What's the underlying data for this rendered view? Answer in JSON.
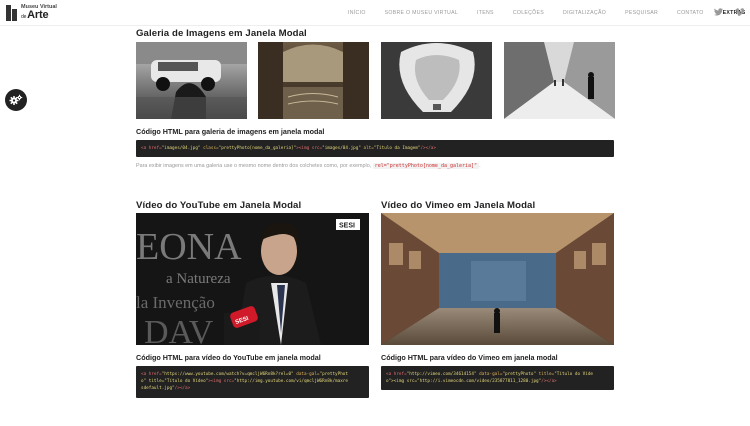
{
  "header": {
    "logo_line1": "Museu Virtual",
    "logo_de": "de",
    "logo_line2": "Arte",
    "nav": [
      {
        "label": "INÍCIO"
      },
      {
        "label": "SOBRE O MUSEU VIRTUAL"
      },
      {
        "label": "ITENS"
      },
      {
        "label": "COLEÇÕES"
      },
      {
        "label": "DIGITALIZAÇÃO"
      },
      {
        "label": "PESQUISAR"
      },
      {
        "label": "CONTATO"
      },
      {
        "label": "EXTRAS"
      }
    ],
    "active_nav": "EXTRAS",
    "social_icons": [
      "twitter-icon",
      "vimeo-icon"
    ]
  },
  "side": {
    "icon": "gears-icon"
  },
  "gallery": {
    "title": "Galeria de Imagens em Janela Modal",
    "code_title": "Código HTML para galeria de imagens em janela modal",
    "code": {
      "p1": "<a href=",
      "p2": "\"images/04.jpg\"",
      "p3": " class=",
      "p4": "\"prettyPhoto[nome_da_galeria]\"",
      "p5": "><img src=",
      "p6": "\"images/04.jpg\"",
      "p7": " alt=",
      "p8": "\"Título da Imagem\"",
      "p9": "/></a>"
    },
    "note": "Para exibir imagens em uma galeria use o mesmo nome dentro dos colchetes como, por exemplo,",
    "note_code": "rel=\"prettyPhoto[nome_da_galeria]\"",
    "note_end": "."
  },
  "youtube": {
    "title": "Vídeo do YouTube em Janela Modal",
    "code_title": "Código HTML para vídeo do YouTube em janela modal",
    "code_line1a": "<a href=",
    "code_line1b": "\"https://www.youtube.com/watch?v=qmcljW6Rn8k?rel=0\"",
    "code_line1c": " data-gal=",
    "code_line1d": "\"prettyPhot",
    "code_line2a": "o\" title=",
    "code_line2b": "\"Título do Vídeo\"",
    "code_line2c": "><img src=",
    "code_line2d": "\"http://img.youtube.com/vi/qmcljW6Rn8k/maxre",
    "code_line3a": "sdefault.jpg\"",
    "code_line3b": "/></a>",
    "video_text": {
      "sesi": "SESI",
      "big1": "EONA",
      "big2": "a Natureza",
      "big3": "la Invenção",
      "big4": "DAV"
    }
  },
  "vimeo": {
    "title": "Vídeo do Vimeo em Janela Modal",
    "code_title": "Código HTML para vídeo do Vimeo em janela modal",
    "code_line1a": "<a href=",
    "code_line1b": "\"http://vimeo.com/34614154\"",
    "code_line1c": " data-gal=",
    "code_line1d": "\"prettyPhoto\"",
    "code_line1e": " title=",
    "code_line1f": "\"Título do Víde",
    "code_line2a": "o\"><img src=",
    "code_line2b": "\"http://i.vimeocdn.com/video/235877811_1280.jpg\"",
    "code_line2c": "/></a>"
  }
}
